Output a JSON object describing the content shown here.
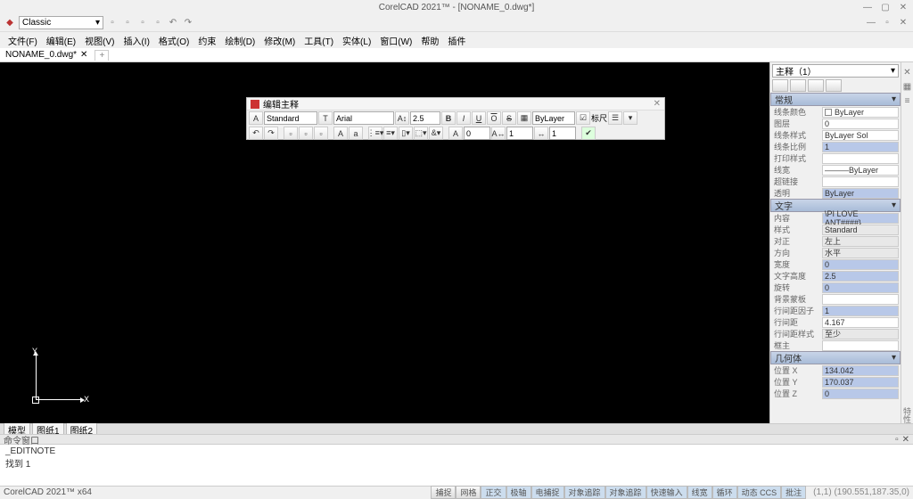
{
  "app": {
    "title": "CorelCAD 2021™ - [NONAME_0.dwg*]"
  },
  "workspace": "Classic",
  "menus": [
    "文件(F)",
    "编辑(E)",
    "视图(V)",
    "插入(I)",
    "格式(O)",
    "约束",
    "绘制(D)",
    "修改(M)",
    "工具(T)",
    "实体(L)",
    "窗口(W)",
    "帮助",
    "插件"
  ],
  "doc_tab": "NONAME_0.dwg*",
  "axes": {
    "x": "X",
    "y": "Y"
  },
  "editor": {
    "title": "编辑主释",
    "style": "Standard",
    "font": "Arial",
    "height": "2.5",
    "btns_fmt": [
      "B",
      "I",
      "U",
      "O",
      "S"
    ],
    "bylayer": "ByLayer",
    "ruler": "标尺",
    "num_a": "0",
    "num_b": "1",
    "num_c": "1"
  },
  "props": {
    "type_label": "主释（1）",
    "sections": {
      "general": "常规",
      "text": "文字",
      "geom": "几何体"
    },
    "general": [
      {
        "k": "线条颜色",
        "v": "ByLayer",
        "swatch": true
      },
      {
        "k": "图层",
        "v": "0"
      },
      {
        "k": "线条样式",
        "v": "ByLayer     Sol"
      },
      {
        "k": "线条比例",
        "v": "1",
        "edit": true
      },
      {
        "k": "打印样式",
        "v": ""
      },
      {
        "k": "线宽",
        "v": "———ByLayer"
      },
      {
        "k": "超链接",
        "v": ""
      },
      {
        "k": "透明",
        "v": "ByLayer",
        "edit": true
      }
    ],
    "text": [
      {
        "k": "内容",
        "v": "\\PI LOVE ANT####}",
        "edit": true
      },
      {
        "k": "样式",
        "v": "Standard",
        "half": true
      },
      {
        "k": "对正",
        "v": "左上",
        "half": true
      },
      {
        "k": "方向",
        "v": "水平",
        "half": true
      },
      {
        "k": "宽度",
        "v": "0",
        "edit": true
      },
      {
        "k": "文字高度",
        "v": "2.5",
        "edit": true
      },
      {
        "k": "旋转",
        "v": "0",
        "edit": true
      },
      {
        "k": "背景蒙板",
        "v": ""
      },
      {
        "k": "行间距因子",
        "v": "1",
        "edit": true
      },
      {
        "k": "行间距",
        "v": "4.167"
      },
      {
        "k": "行间距样式",
        "v": "至少",
        "half": true
      },
      {
        "k": "框主",
        "v": ""
      }
    ],
    "geom": [
      {
        "k": "位置 X",
        "v": "134.042",
        "edit": true
      },
      {
        "k": "位置 Y",
        "v": "170.037",
        "edit": true
      },
      {
        "k": "位置 Z",
        "v": "0",
        "edit": true
      }
    ]
  },
  "sheets": [
    "模型",
    "图纸1",
    "图纸2"
  ],
  "cmd": {
    "header": "命令窗口",
    "line1": "_EDITNOTE",
    "line2": "找到 1"
  },
  "status": {
    "version": "CorelCAD 2021™ x64",
    "buttons": [
      "捕捉",
      "网格",
      "正交",
      "极轴",
      "电捕捉",
      "对象追踪",
      "对象追踪",
      "快速输入",
      "线宽",
      "循环",
      "动态 CCS",
      "批注"
    ],
    "coords": "(1,1)  (190.551,187.35,0)"
  }
}
